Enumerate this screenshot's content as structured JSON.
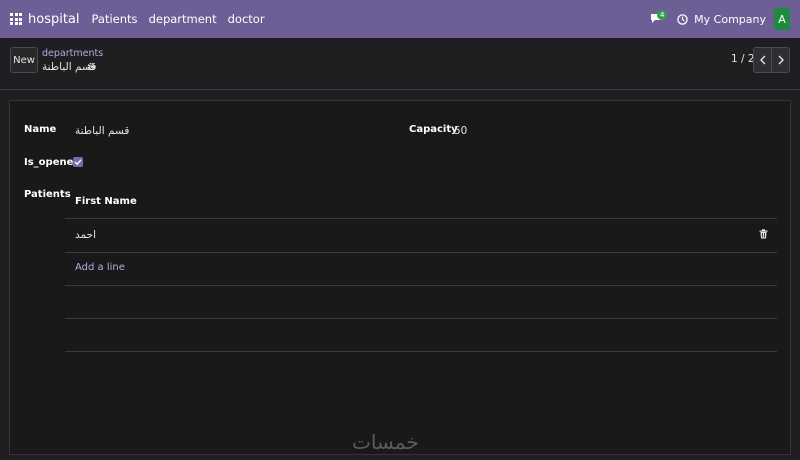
{
  "navbar": {
    "brand": "hospital",
    "menu": [
      "Patients",
      "department",
      "doctor"
    ],
    "chat_badge_count": "4",
    "company": "My Company",
    "avatar_letter": "A",
    "bg_color": "#6d5e96"
  },
  "control_panel": {
    "new_label": "New",
    "breadcrumb_parent": "departments",
    "record_title": "قسم الباطنة",
    "pager_value": "1 / 2"
  },
  "form": {
    "name_label": "Name",
    "name_value": "قسم الباطنة",
    "capacity_label": "Capacity",
    "capacity_value": "50",
    "is_opened_label": "Is_opened",
    "is_opened_checked": true,
    "patients_label": "Patients",
    "patients_table": {
      "column_header": "First Name",
      "rows": [
        "احمد"
      ],
      "add_line_label": "Add a line"
    }
  },
  "watermark": "خمسات",
  "icons": [
    "apps-grid-icon",
    "chat-icon",
    "clock-icon",
    "gear-icon",
    "chevron-left-icon",
    "chevron-right-icon",
    "trash-icon",
    "check-icon"
  ]
}
